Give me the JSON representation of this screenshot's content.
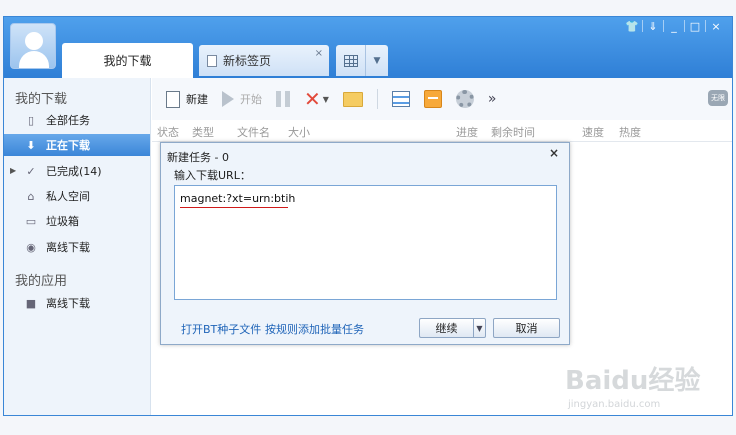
{
  "tabs": {
    "active_label": "我的下载",
    "new_tab_label": "新标签页",
    "new_tab_close": "×"
  },
  "window_controls": {
    "skin": "👕",
    "menu": "⇓",
    "minimize": "_",
    "maximize": "□",
    "close": "×"
  },
  "sidebar": {
    "section_downloads": "我的下载",
    "items": [
      {
        "label": "全部任务",
        "icon": "document-icon"
      },
      {
        "label": "正在下载",
        "icon": "download-arrow-icon",
        "active": true
      },
      {
        "label": "已完成(14)",
        "icon": "check-icon"
      },
      {
        "label": "私人空间",
        "icon": "lock-icon"
      },
      {
        "label": "垃圾箱",
        "icon": "trash-icon"
      },
      {
        "label": "离线下载",
        "icon": "cloud-download-icon"
      }
    ],
    "section_apps": "我的应用",
    "app_items": [
      {
        "label": "离线下载",
        "icon": "offline-app-icon"
      }
    ]
  },
  "toolbar": {
    "new_label": "新建",
    "start_label": "开始",
    "more": "»",
    "chip": "无限"
  },
  "columns": [
    "状态",
    "类型",
    "文件名",
    "大小",
    "进度",
    "剩余时间",
    "速度",
    "热度"
  ],
  "dialog": {
    "title": "新建任务 - 0",
    "close": "×",
    "url_label": "输入下载URL：",
    "url_value": "magnet:?xt=urn:btih",
    "open_bt_link": "打开BT种子文件",
    "batch_link": "按规则添加批量任务",
    "continue_label": "继续",
    "dropdown": "▼",
    "cancel_label": "取消"
  },
  "watermark": {
    "main": "Baidu经验",
    "sub": "jingyan.baidu.com"
  }
}
